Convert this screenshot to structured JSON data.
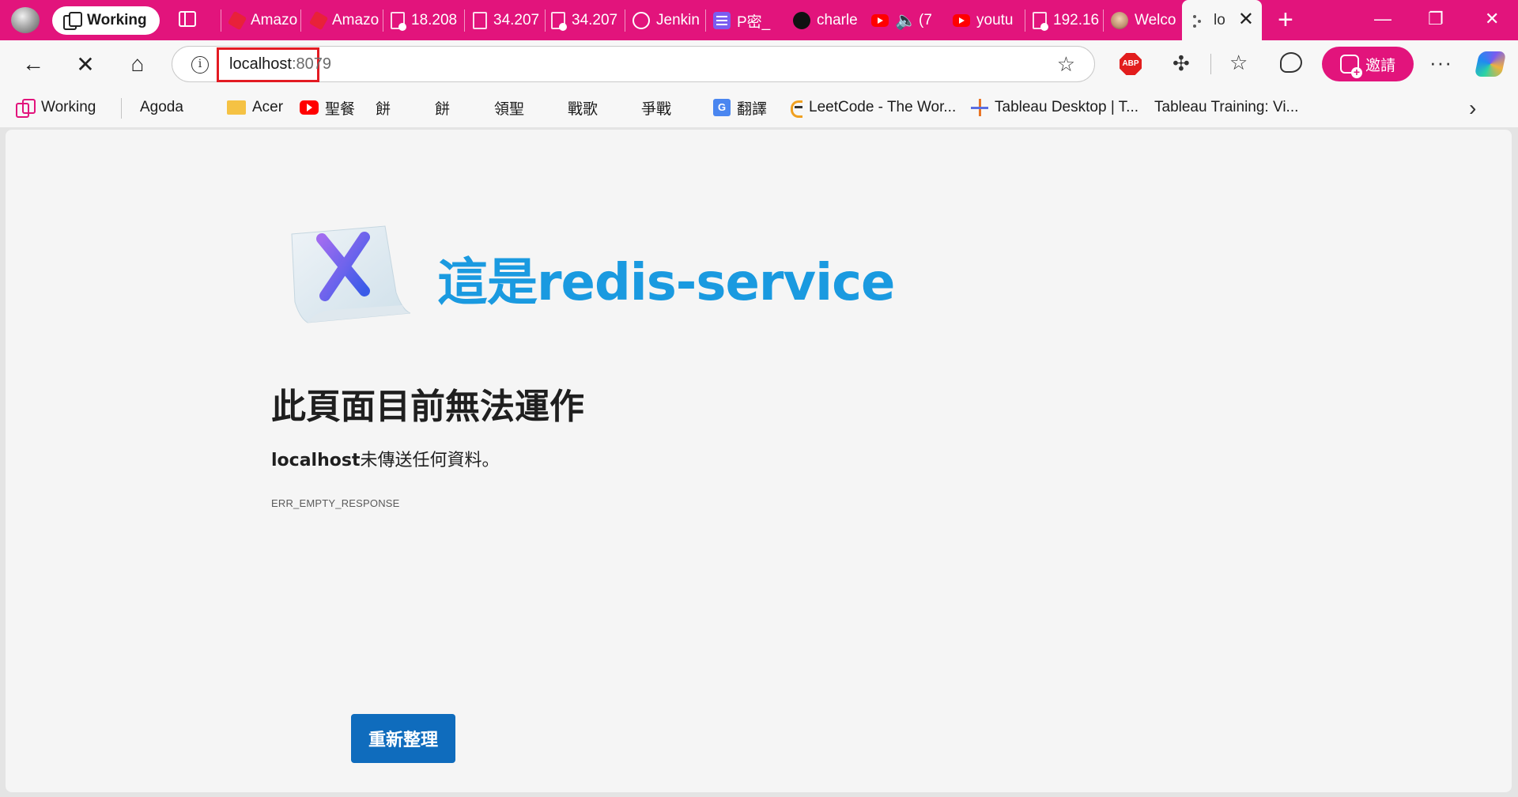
{
  "window": {
    "workspace_label": "Working",
    "tabs": [
      {
        "title": "Amazo",
        "icon": "aws-cube-icon"
      },
      {
        "title": "Amazo",
        "icon": "aws-cube-icon"
      },
      {
        "title": "18.208",
        "icon": "broken-pdf-icon"
      },
      {
        "title": "34.207",
        "icon": "page-icon"
      },
      {
        "title": "34.207",
        "icon": "broken-pdf-icon"
      },
      {
        "title": "Jenkin",
        "icon": "chatgpt-icon"
      },
      {
        "title": "P密_",
        "icon": "doc-lines-icon"
      },
      {
        "title": "charle",
        "icon": "github-icon"
      },
      {
        "title": "(7",
        "icon": "youtube-icon"
      },
      {
        "title": "youtu",
        "icon": "youtube-icon"
      },
      {
        "title": "192.16",
        "icon": "broken-pdf-icon"
      },
      {
        "title": "Welco",
        "icon": "avatar-icon"
      }
    ],
    "active_tab": {
      "title": "lo"
    }
  },
  "navbar": {
    "url_host": "localhost",
    "url_port": ":8079",
    "abp_label": "ABP",
    "invite_label": "邀請"
  },
  "bookmarks": [
    {
      "label": "Working",
      "icon": "workspaces-icon"
    },
    {
      "label": "Agoda",
      "icon": "page-icon"
    },
    {
      "label": "Acer",
      "icon": "folder-icon"
    },
    {
      "label": "聖餐",
      "icon": "youtube-icon"
    },
    {
      "label": "餅",
      "icon": "page-icon"
    },
    {
      "label": "餅",
      "icon": "page-icon"
    },
    {
      "label": "領聖",
      "icon": "page-icon"
    },
    {
      "label": "戰歌",
      "icon": "page-icon"
    },
    {
      "label": "爭戰",
      "icon": "page-icon"
    },
    {
      "label": "翻譯",
      "icon": "google-translate-icon"
    },
    {
      "label": "LeetCode - The Wor...",
      "icon": "leetcode-icon"
    },
    {
      "label": "Tableau Desktop | T...",
      "icon": "tableau-icon"
    },
    {
      "label": "Tableau Training: Vi...",
      "icon": "page-icon"
    }
  ],
  "content": {
    "banner_text": "這是redis-service",
    "error_title": "此頁面目前無法運作",
    "error_host": "localhost",
    "error_desc_suffix": "未傳送任何資料。",
    "error_code": "ERR_EMPTY_RESPONSE",
    "reload_label": "重新整理"
  },
  "colors": {
    "titlebar": "#e2147c",
    "banner_text": "#1a9ae0",
    "reload_button": "#0f6cbd",
    "url_highlight": "#e31b23"
  }
}
